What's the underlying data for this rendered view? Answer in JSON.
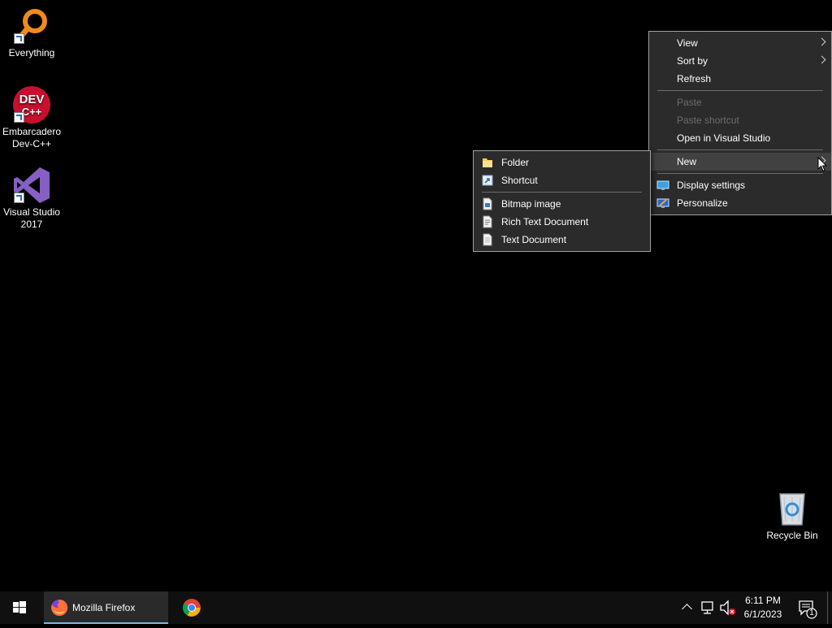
{
  "desktop": {
    "icons": [
      {
        "label": "Everything",
        "icon": "everything-magnifier-icon"
      },
      {
        "label": "Embarcadero Dev-C++",
        "icon": "devcpp-icon",
        "badge": "DEV C++"
      },
      {
        "label": "Visual Studio 2017",
        "icon": "visual-studio-icon"
      },
      {
        "label": "Recycle Bin",
        "icon": "recycle-bin-icon"
      }
    ]
  },
  "context_menu": {
    "items": [
      {
        "label": "View",
        "disabled": false,
        "submenu": true
      },
      {
        "label": "Sort by",
        "disabled": false,
        "submenu": true
      },
      {
        "label": "Refresh",
        "disabled": false
      },
      {
        "label": "Paste",
        "disabled": true
      },
      {
        "label": "Paste shortcut",
        "disabled": true
      },
      {
        "label": "Open in Visual Studio",
        "disabled": false
      },
      {
        "label": "New",
        "disabled": false,
        "submenu": true,
        "highlighted": true
      },
      {
        "label": "Display settings",
        "icon": "display-settings-icon"
      },
      {
        "label": "Personalize",
        "icon": "personalize-icon"
      }
    ]
  },
  "new_submenu": {
    "items": [
      {
        "label": "Folder",
        "icon": "folder-icon"
      },
      {
        "label": "Shortcut",
        "icon": "shortcut-icon"
      },
      {
        "label": "Bitmap image",
        "icon": "bitmap-icon"
      },
      {
        "label": "Rich Text Document",
        "icon": "rich-text-icon"
      },
      {
        "label": "Text Document",
        "icon": "text-document-icon"
      }
    ]
  },
  "taskbar": {
    "start_icon": "windows-start-icon",
    "apps": [
      {
        "label": "Mozilla Firefox",
        "icon": "firefox-icon",
        "active": true
      },
      {
        "label": "",
        "icon": "chrome-icon",
        "active": false
      }
    ],
    "tray": {
      "time": "6:11 PM",
      "date": "6/1/2023",
      "notification_count": "1"
    }
  },
  "colors": {
    "taskbar_bg": "#101010",
    "menu_bg": "#2b2b2b",
    "menu_highlight": "#414141",
    "active_underline": "#76b9ed"
  }
}
